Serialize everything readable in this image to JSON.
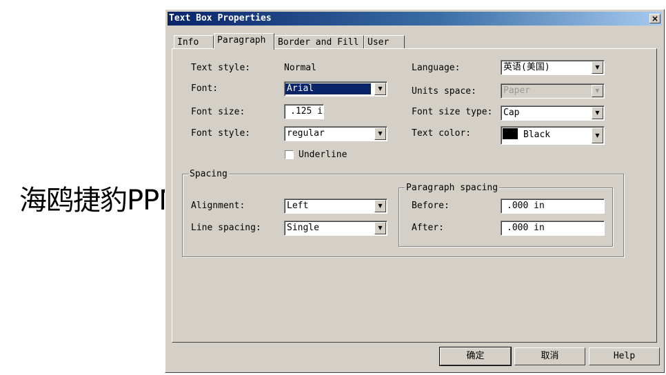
{
  "background": {
    "text": "海鸥捷豹PPM"
  },
  "dialog": {
    "title": "Text Box Properties",
    "close_label": "×",
    "tabs": [
      {
        "label": "Info"
      },
      {
        "label": "Paragraph"
      },
      {
        "label": "Border and Fill"
      },
      {
        "label": "User"
      }
    ],
    "active_tab": "Paragraph",
    "fields": {
      "text_style_label": "Text style:",
      "text_style_value": "Normal",
      "font_label": "Font:",
      "font_value": "Arial",
      "font_size_label": "Font size:",
      "font_size_value": ".125 i",
      "font_style_label": "Font style:",
      "font_style_value": "regular",
      "underline_label": "Underline",
      "language_label": "Language:",
      "language_value": "英语(美国)",
      "units_space_label": "Units space:",
      "units_space_value": "Paper",
      "font_size_type_label": "Font size type:",
      "font_size_type_value": "Cap",
      "text_color_label": "Text color:",
      "text_color_value": "Black",
      "text_color_hex": "#000000"
    },
    "spacing": {
      "group_title": "Spacing",
      "alignment_label": "Alignment:",
      "alignment_value": "Left",
      "line_spacing_label": "Line spacing:",
      "line_spacing_value": "Single",
      "paragraph_spacing_title": "Paragraph spacing",
      "before_label": "Before:",
      "before_value": ".000 in",
      "after_label": "After:",
      "after_value": ".000 in"
    },
    "buttons": {
      "ok": "确定",
      "cancel": "取消",
      "help": "Help"
    },
    "colors": {
      "title_start": "#0a246a",
      "title_end": "#a6caf0",
      "face": "#d4d0c8"
    }
  }
}
